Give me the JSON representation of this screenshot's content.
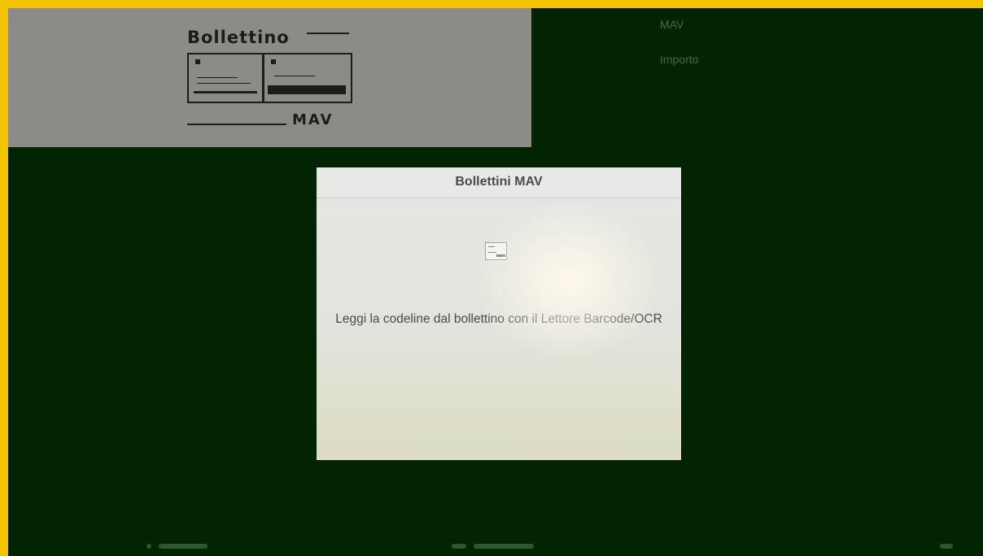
{
  "illustration": {
    "title": "Bollettino",
    "footer": "MAV"
  },
  "info": {
    "mav_label": "MAV",
    "importo_label": "Importo"
  },
  "dialog": {
    "title": "Bollettini MAV",
    "icon": "bill-icon",
    "message": "Leggi la codeline dal bollettino con il Lettore Barcode/OCR"
  },
  "colors": {
    "frame": "#f2c200",
    "background": "#032403",
    "panel": "#8a8c85",
    "dialog": "#e6e6e4",
    "info_text": "#3d6e3d"
  }
}
